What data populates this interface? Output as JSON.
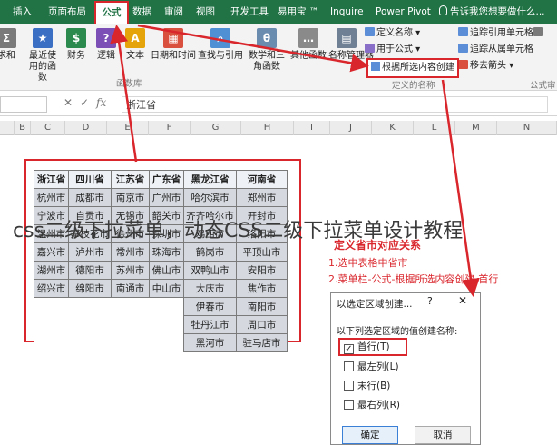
{
  "menu": {
    "tabs": [
      "插入",
      "页面布局",
      "公式",
      "数据",
      "审阅",
      "视图",
      "开发工具",
      "易用宝 ™",
      "Inquire",
      "Power Pivot"
    ],
    "active_tab": "公式",
    "tell_me": "告诉我您想要做什么..."
  },
  "ribbon": {
    "buttons": {
      "insert_function": "求和",
      "recent": "最近使用的函数",
      "financial": "财务",
      "logical": "逻辑",
      "text": "文本",
      "datetime": "日期和时间",
      "lookup": "查找与引用",
      "math": "数学和三角函数",
      "other": "其他函数",
      "name_manager": "名称管理器"
    },
    "group_function_library": "函数库",
    "group_defined_names": "定义的名称",
    "define_name": "定义名称",
    "use_in_formula": "用于公式",
    "create_from_selection": "根据所选内容创建",
    "trace_precedents": "追踪引用单元格",
    "trace_dependents": "追踪从属单元格",
    "remove_arrows": "移去箭头",
    "formula_label": "公式审"
  },
  "formula_bar": {
    "fx": "fx",
    "value": "浙江省"
  },
  "columns": [
    "B",
    "C",
    "D",
    "E",
    "F",
    "G",
    "H",
    "I",
    "J",
    "K",
    "L",
    "M",
    "N"
  ],
  "table": {
    "headers": [
      "浙江省",
      "四川省",
      "江苏省",
      "广东省",
      "黑龙江省",
      "河南省"
    ],
    "rows": [
      [
        "杭州市",
        "成都市",
        "南京市",
        "广州市",
        "哈尔滨市",
        "郑州市"
      ],
      [
        "宁波市",
        "自贡市",
        "无锡市",
        "韶关市",
        "齐齐哈尔市",
        "开封市"
      ],
      [
        "温州市",
        "攀枝花市",
        "徐州市",
        "深圳市",
        "鸡西市",
        "洛阳市"
      ],
      [
        "嘉兴市",
        "泸州市",
        "常州市",
        "珠海市",
        "鹤岗市",
        "平顶山市"
      ],
      [
        "湖州市",
        "德阳市",
        "苏州市",
        "佛山市",
        "双鸭山市",
        "安阳市"
      ],
      [
        "绍兴市",
        "绵阳市",
        "南通市",
        "中山市",
        "大庆市",
        "焦作市"
      ],
      [
        "",
        "",
        "",
        "",
        "伊春市",
        "南阳市"
      ],
      [
        "",
        "",
        "",
        "",
        "牡丹江市",
        "周口市"
      ],
      [
        "",
        "",
        "",
        "",
        "黑河市",
        "驻马店市"
      ]
    ]
  },
  "overlay_title": "css二级下拉菜单，动态CSS二级下拉菜单设计教程",
  "annotation": {
    "title": "定义省市对应关系",
    "step1": "1.选中表格中省市",
    "step2": "2.菜单栏-公式-根据所选内容创建-首行"
  },
  "dialog": {
    "title": "以选定区域创建...",
    "help": "?",
    "close": "✕",
    "prompt": "以下列选定区域的值创建名称:",
    "options": [
      {
        "label": "首行(T)",
        "checked": true
      },
      {
        "label": "最左列(L)",
        "checked": false
      },
      {
        "label": "末行(B)",
        "checked": false
      },
      {
        "label": "最右列(R)",
        "checked": false
      }
    ],
    "ok": "确定",
    "cancel": "取消"
  },
  "colors": {
    "excel_green": "#217346",
    "annotation_red": "#d9262c"
  }
}
